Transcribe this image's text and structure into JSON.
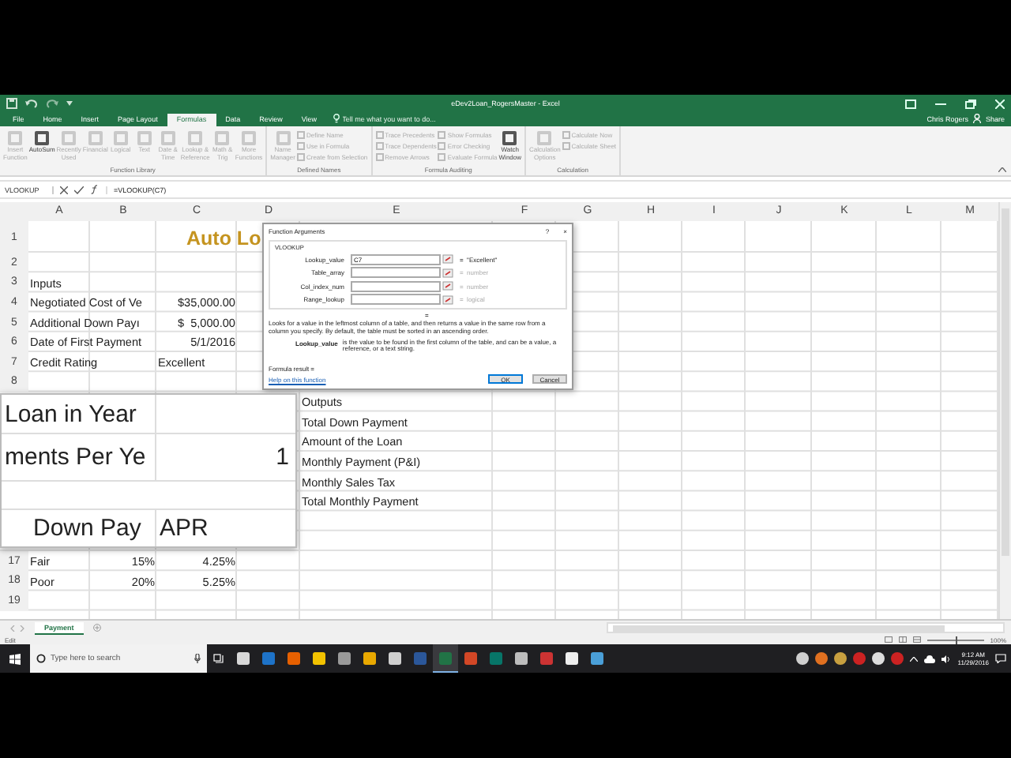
{
  "window": {
    "title": "eDev2Loan_RogersMaster - Excel",
    "user": "Chris Rogers",
    "share": "Share"
  },
  "tabs": [
    {
      "label": "File",
      "selected": false
    },
    {
      "label": "Home",
      "selected": false
    },
    {
      "label": "Insert",
      "selected": false
    },
    {
      "label": "Page Layout",
      "selected": false
    },
    {
      "label": "Formulas",
      "selected": true
    },
    {
      "label": "Data",
      "selected": false
    },
    {
      "label": "Review",
      "selected": false
    },
    {
      "label": "View",
      "selected": false
    }
  ],
  "tell_me": {
    "placeholder": "Tell me what you want to do..."
  },
  "ribbon": [
    {
      "label": "Function Library",
      "items": [
        {
          "label": "Insert Function",
          "kind": "large",
          "disabled": true
        },
        {
          "label": "AutoSum",
          "kind": "large",
          "disabled": false
        },
        {
          "label": "Recently Used",
          "kind": "large",
          "disabled": true
        },
        {
          "label": "Financial",
          "kind": "large",
          "disabled": true
        },
        {
          "label": "Logical",
          "kind": "large",
          "disabled": true
        },
        {
          "label": "Text",
          "kind": "large",
          "disabled": true
        },
        {
          "label": "Date & Time",
          "kind": "large",
          "disabled": true
        },
        {
          "label": "Lookup & Reference",
          "kind": "large",
          "disabled": true
        },
        {
          "label": "Math & Trig",
          "kind": "large",
          "disabled": true
        },
        {
          "label": "More Functions",
          "kind": "large",
          "disabled": true
        }
      ]
    },
    {
      "label": "Defined Names",
      "items": [
        {
          "label": "Name Manager",
          "kind": "large",
          "disabled": true
        },
        {
          "label": "Define Name",
          "kind": "small",
          "disabled": true
        },
        {
          "label": "Use in Formula",
          "kind": "small",
          "disabled": true
        },
        {
          "label": "Create from Selection",
          "kind": "small",
          "disabled": true
        }
      ]
    },
    {
      "label": "Formula Auditing",
      "items": [
        {
          "label": "Trace Precedents",
          "kind": "small",
          "disabled": true
        },
        {
          "label": "Trace Dependents",
          "kind": "small",
          "disabled": true
        },
        {
          "label": "Remove Arrows",
          "kind": "small",
          "disabled": true
        },
        {
          "label": "Show Formulas",
          "kind": "small",
          "disabled": true
        },
        {
          "label": "Error Checking",
          "kind": "small",
          "disabled": true
        },
        {
          "label": "Evaluate Formula",
          "kind": "small",
          "disabled": true
        },
        {
          "label": "Watch Window",
          "kind": "large",
          "disabled": false
        }
      ]
    },
    {
      "label": "Calculation",
      "items": [
        {
          "label": "Calculation Options",
          "kind": "large",
          "disabled": true
        },
        {
          "label": "Calculate Now",
          "kind": "small",
          "disabled": true
        },
        {
          "label": "Calculate Sheet",
          "kind": "small",
          "disabled": true
        }
      ]
    }
  ],
  "formula_bar": {
    "name_box": "VLOOKUP",
    "formula": "=VLOOKUP(C7)"
  },
  "sheet": {
    "columns": [
      "A",
      "B",
      "C",
      "D",
      "E",
      "F",
      "G",
      "H",
      "I",
      "J",
      "K",
      "L",
      "M"
    ],
    "rows": [
      {
        "number": "1",
        "c": {
          "text": "Auto Lo",
          "kind": "title"
        }
      },
      {
        "number": "2"
      },
      {
        "number": "3",
        "a": {
          "text": "Inputs",
          "kind": "text"
        }
      },
      {
        "number": "4",
        "a": {
          "text": "Negotiated Cost of Ve",
          "kind": "text"
        },
        "c": {
          "text": "$35,000.00",
          "kind": "number"
        }
      },
      {
        "number": "5",
        "a": {
          "text": "Additional Down Payı",
          "kind": "text"
        },
        "c": {
          "text": "$  5,000.00",
          "kind": "number"
        }
      },
      {
        "number": "6",
        "a": {
          "text": "Date of First Payment",
          "kind": "text"
        },
        "c": {
          "text": "5/1/2016",
          "kind": "number"
        }
      },
      {
        "number": "7",
        "a": {
          "text": "Credit Rating",
          "kind": "text"
        },
        "c": {
          "text": "Excellent",
          "kind": "text"
        }
      },
      {
        "number": "8"
      },
      {
        "e": {
          "text": "Outputs",
          "kind": "text"
        }
      },
      {
        "e": {
          "text": "Total Down Payment",
          "kind": "text"
        }
      },
      {
        "e": {
          "text": "Amount of the Loan",
          "kind": "text"
        }
      },
      {
        "e": {
          "text": "Monthly Payment (P&I)",
          "kind": "text"
        }
      },
      {
        "e": {
          "text": "Monthly Sales Tax",
          "kind": "text"
        }
      },
      {
        "e": {
          "text": "Total Monthly Payment",
          "kind": "text"
        }
      },
      {},
      {},
      {
        "number": "17",
        "a": {
          "text": "Fair",
          "kind": "text"
        },
        "b": {
          "text": "15%",
          "kind": "number"
        },
        "c": {
          "text": "4.25%",
          "kind": "number"
        }
      },
      {
        "number": "18",
        "a": {
          "text": "Poor",
          "kind": "text"
        },
        "b": {
          "text": "20%",
          "kind": "number"
        },
        "c": {
          "text": "5.25%",
          "kind": "number"
        }
      },
      {
        "number": "19"
      }
    ]
  },
  "magnifier": [
    {
      "left": {
        "text": "Loan in Year",
        "kind": "text"
      }
    },
    {
      "left": {
        "text": "ments Per Ye",
        "kind": "text"
      },
      "right": {
        "text": "1",
        "kind": "number"
      }
    },
    {
      "left": {
        "text": "Down Pay",
        "kind": "indent"
      },
      "right": {
        "text": "APR",
        "kind": "text"
      }
    }
  ],
  "dialog": {
    "title": "Function Arguments",
    "help": "?",
    "close": "×",
    "function": "VLOOKUP",
    "arguments": [
      {
        "label": "Lookup_value",
        "value": "C7",
        "result": "=  \"Excellent\""
      },
      {
        "label": "Table_array",
        "result": "=  number"
      },
      {
        "label": "Col_index_num",
        "result": "=  number"
      },
      {
        "label": "Range_lookup",
        "result": "=  logical"
      }
    ],
    "total": "=",
    "description": "Looks for a value in the leftmost column of a table, and then returns a value in the same row from a column you specify. By default, the table must be sorted in an ascending order.",
    "argument_help": {
      "name": "Lookup_value",
      "text": "is the value to be found in the first column of the table, and can be a value, a reference, or a text string."
    },
    "formula_result": "Formula result =",
    "help_link": "Help on this function",
    "buttons": [
      {
        "label": "OK",
        "default": true
      },
      {
        "label": "Cancel",
        "default": false
      }
    ]
  },
  "sheet_tabs": [
    {
      "label": "Payment",
      "selected": true
    }
  ],
  "status_bar": {
    "mode": "Edit",
    "zoom": {
      "level": 0.5,
      "reading": "100%"
    }
  },
  "taskbar": {
    "search": {
      "placeholder": "Type here to search"
    },
    "apps": [
      {
        "color": "#d8d8d8",
        "selected": false
      },
      {
        "color": "#1e73c8",
        "selected": false
      },
      {
        "color": "#e66000",
        "selected": false
      },
      {
        "color": "#f2c200",
        "selected": false
      },
      {
        "color": "#9a9a9a",
        "selected": false
      },
      {
        "color": "#e8a800",
        "selected": false
      },
      {
        "color": "#cfcfcf",
        "selected": false
      },
      {
        "color": "#2b579a",
        "selected": false
      },
      {
        "color": "#217346",
        "selected": true
      },
      {
        "color": "#d24726",
        "selected": false
      },
      {
        "color": "#077568",
        "selected": false
      },
      {
        "color": "#bdbdbd",
        "selected": false
      },
      {
        "color": "#cc3333",
        "selected": false
      },
      {
        "color": "#eeeeee",
        "selected": false
      },
      {
        "color": "#4a9fd8",
        "selected": false
      }
    ],
    "tray": [
      {
        "color": "#cfcfcf"
      },
      {
        "color": "#e07020"
      },
      {
        "color": "#c8a040"
      },
      {
        "color": "#cc2222"
      },
      {
        "color": "#dddddd"
      },
      {
        "color": "#cc2222"
      }
    ],
    "time": "9:12 AM",
    "date": "11/29/2016"
  }
}
